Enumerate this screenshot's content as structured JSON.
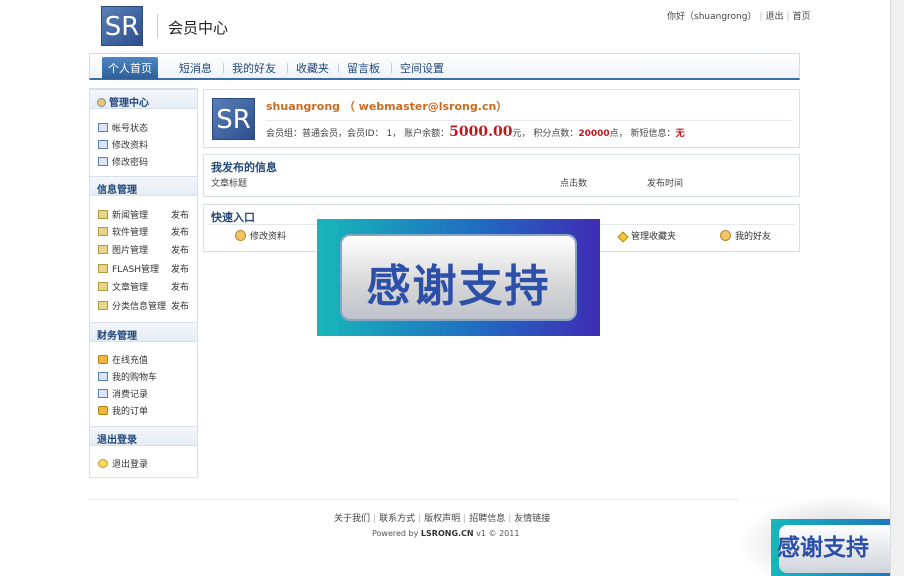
{
  "header": {
    "logo_text": "SR",
    "title": "会员中心",
    "greeting": "你好（shuangrong）",
    "logout": "退出",
    "home": "首页"
  },
  "nav": {
    "tabs": [
      "个人首页",
      "短消息",
      "我的好友",
      "收藏夹",
      "留言板",
      "空间设置"
    ],
    "active_index": 0
  },
  "sidebar": {
    "management": {
      "title": "管理中心",
      "items": [
        "帐号状态",
        "修改资料",
        "修改密码"
      ]
    },
    "info": {
      "title": "信息管理",
      "publish_label": "发布",
      "items": [
        "新闻管理",
        "软件管理",
        "图片管理",
        "FLASH管理",
        "文章管理",
        "分类信息管理"
      ]
    },
    "finance": {
      "title": "财务管理",
      "items": [
        "在线充值",
        "我的购物车",
        "消费记录",
        "我的订单"
      ]
    },
    "logout": {
      "title": "退出登录",
      "items": [
        "退出登录"
      ]
    }
  },
  "profile": {
    "avatar_text": "SR",
    "username_line": "shuangrong （ webmaster@lsrong.cn）",
    "group_label": "会员组：",
    "group_value": "普通会员",
    "id_label": "，会员ID：",
    "id_value": "1",
    "balance_label": "，  账户余额：",
    "balance_value": "5000.00",
    "balance_unit": "元，",
    "points_label": "积分点数：",
    "points_value": "20000",
    "points_unit": "点，",
    "msg_label": "新短信息：",
    "msg_value": "无"
  },
  "my_posts": {
    "title": "我发布的信息",
    "columns": [
      "文章标题",
      "点击数",
      "发布时间"
    ]
  },
  "quick": {
    "title": "快速入口",
    "items": [
      "修改资料",
      "管理收藏夹",
      "我的好友"
    ]
  },
  "overlay": {
    "text": "感谢支持"
  },
  "footer": {
    "links": [
      "关于我们",
      "联系方式",
      "版权声明",
      "招聘信息",
      "友情链接"
    ],
    "powered_prefix": "Powered by ",
    "powered_brand": "LSRONG.CN",
    "powered_suffix": " v1 © 2011"
  },
  "corner_badge": {
    "text": "感谢支持"
  },
  "colors": {
    "brand_blue": "#23487a",
    "accent_red": "#c0171e",
    "username_orange": "#cc6b1c"
  }
}
